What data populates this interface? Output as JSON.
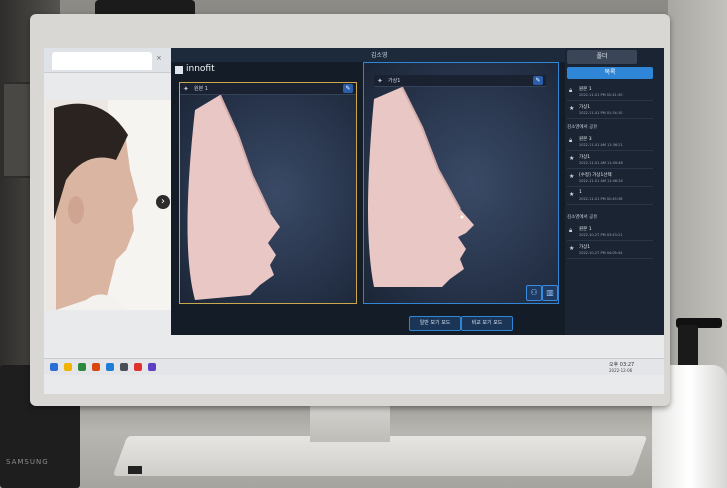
{
  "browser": {
    "tab_title": "",
    "address": ""
  },
  "app": {
    "window_title": "김소영",
    "logo_text": "innofit",
    "left_view": {
      "label": "원본 1"
    },
    "right_view": {
      "label": "가상1"
    },
    "mode_buttons": [
      "일반 보기 모드",
      "비교 보기 모드"
    ]
  },
  "sidebar": {
    "folder_label": "폴더",
    "list_label": "목록",
    "items_top": [
      {
        "icon": "lock-icon",
        "name": "원본 1",
        "date": "2022-11-01 PM 02:41:30"
      },
      {
        "icon": "star-icon",
        "name": "가상1",
        "date": "2022-11-01 PM 01:34:10"
      }
    ],
    "group1_title": "김소영에서 공유",
    "items_group1": [
      {
        "icon": "lock-icon",
        "name": "원본 3",
        "date": "2022-11-01 AM 11:36:21"
      },
      {
        "icon": "star-icon",
        "name": "가상1",
        "date": "2022-11-01 AM 11:45:46"
      },
      {
        "icon": "star-icon",
        "name": "[수정] 가상1선택",
        "date": "2022-11-01 AM 11:46:34"
      },
      {
        "icon": "star-icon",
        "name": "1",
        "date": "2022-11-01 PM 02:45:38"
      }
    ],
    "group2_title": "김소영에서 공유",
    "items_group2": [
      {
        "icon": "lock-icon",
        "name": "원본 1",
        "date": "2022-10-27 PM 03:43:21"
      },
      {
        "icon": "star-icon",
        "name": "가상1",
        "date": "2022-10-27 PM 04:05:44"
      }
    ]
  },
  "taskbar": {
    "time": "오후 03:27",
    "date": "2022-12-06"
  },
  "monitor": {
    "watermark": ""
  }
}
